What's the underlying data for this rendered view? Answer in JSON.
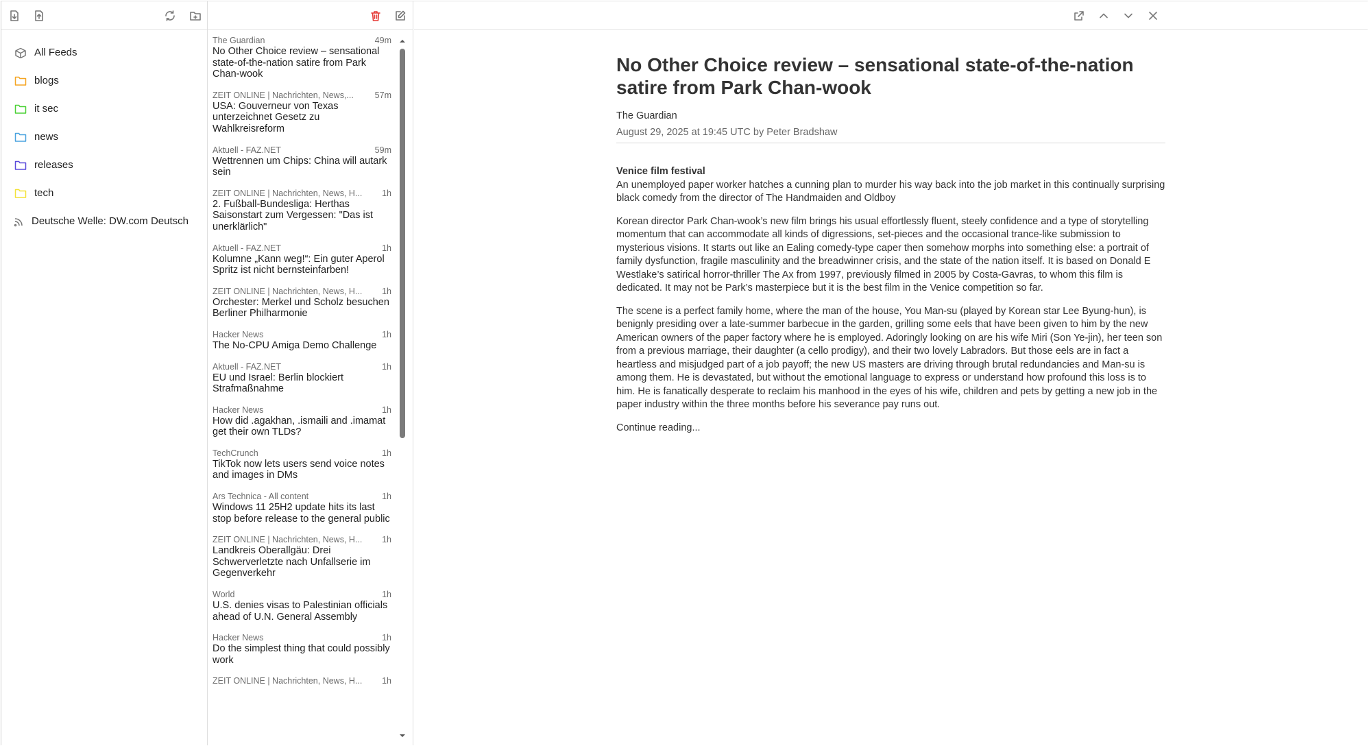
{
  "sidebar": {
    "feeds": [
      {
        "label": "All Feeds",
        "icon": "cube-icon",
        "color": "#777777"
      },
      {
        "label": "blogs",
        "icon": "folder-icon",
        "color": "#f5a623"
      },
      {
        "label": "it sec",
        "icon": "folder-icon",
        "color": "#4cd137"
      },
      {
        "label": "news",
        "icon": "folder-icon",
        "color": "#4aa3df"
      },
      {
        "label": "releases",
        "icon": "folder-icon",
        "color": "#5b4bdb"
      },
      {
        "label": "tech",
        "icon": "folder-icon",
        "color": "#f3e23a"
      },
      {
        "label": "Deutsche Welle: DW.com Deutsch",
        "icon": "rss-icon",
        "color": "#777777"
      }
    ]
  },
  "articles": [
    {
      "source": "The Guardian",
      "time": "49m",
      "title": "No Other Choice review – sensational state-of-the-nation satire from Park Chan-wook"
    },
    {
      "source": "ZEIT ONLINE | Nachrichten, News,...",
      "time": "57m",
      "title": "USA: Gouverneur von Texas unterzeichnet Gesetz zu Wahlkreisreform"
    },
    {
      "source": "Aktuell - FAZ.NET",
      "time": "59m",
      "title": "Wettrennen um Chips: China will autark sein"
    },
    {
      "source": "ZEIT ONLINE | Nachrichten, News, H...",
      "time": "1h",
      "title": "2. Fußball-Bundesliga: Herthas Saisonstart zum Vergessen: \"Das ist unerklärlich\""
    },
    {
      "source": "Aktuell - FAZ.NET",
      "time": "1h",
      "title": "Kolumne „Kann weg!“: Ein guter Aperol Spritz ist nicht bernsteinfarben!"
    },
    {
      "source": "ZEIT ONLINE | Nachrichten, News, H...",
      "time": "1h",
      "title": "Orchester: Merkel und Scholz besuchen Berliner Philharmonie"
    },
    {
      "source": "Hacker News",
      "time": "1h",
      "title": "The No-CPU Amiga Demo Challenge"
    },
    {
      "source": "Aktuell - FAZ.NET",
      "time": "1h",
      "title": "EU und Israel: Berlin blockiert Strafmaßnahme"
    },
    {
      "source": "Hacker News",
      "time": "1h",
      "title": "How did .agakhan, .ismaili and .imamat get their own TLDs?"
    },
    {
      "source": "TechCrunch",
      "time": "1h",
      "title": "TikTok now lets users send voice notes and images in DMs"
    },
    {
      "source": "Ars Technica - All content",
      "time": "1h",
      "title": "Windows 11 25H2 update hits its last stop before release to the general public"
    },
    {
      "source": "ZEIT ONLINE | Nachrichten, News, H...",
      "time": "1h",
      "title": "Landkreis Oberallgäu: Drei Schwerverletzte nach Unfallserie im Gegenverkehr"
    },
    {
      "source": "World",
      "time": "1h",
      "title": "U.S. denies visas to Palestinian officials ahead of U.N. General Assembly"
    },
    {
      "source": "Hacker News",
      "time": "1h",
      "title": "Do the simplest thing that could possibly work"
    },
    {
      "source": "ZEIT ONLINE | Nachrichten, News, H...",
      "time": "1h",
      "title": ""
    }
  ],
  "reader": {
    "title": "No Other Choice review – sensational state-of-the-nation satire from Park Chan-wook",
    "source": "The Guardian",
    "date": "August 29, 2025 at 19:45 UTC by Peter Bradshaw",
    "kicker": "Venice film festival",
    "standfirst": "An unemployed paper worker hatches a cunning plan to murder his way back into the job market in this continually surprising black comedy from the director of The Handmaiden and Oldboy",
    "paragraphs": [
      "Korean director Park Chan-wook’s new film brings his usual effortlessly fluent, steely confidence and a type of storytelling momentum that can accommodate all kinds of digressions, set-pieces and the occasional trance-like submission to mysterious visions. It starts out like an Ealing comedy-type caper then somehow morphs into something else: a portrait of family dysfunction, fragile masculinity and the breadwinner crisis, and the state of the nation itself. It is based on Donald E Westlake’s satirical horror-thriller The Ax from 1997, previously filmed in 2005 by Costa-Gavras, to whom this film is dedicated. It may not be Park’s masterpiece but it is the best film in the Venice competition so far.",
      "The scene is a perfect family home, where the man of the house, You Man-su (played by Korean star Lee Byung-hun), is benignly presiding over a late-summer barbecue in the garden, grilling some eels that have been given to him by the new American owners of the paper factory where he is employed. Adoringly looking on are his wife Miri (Son Ye-jin), her teen son from a previous marriage, their daughter (a cello prodigy), and their two lovely Labradors. But those eels are in fact a heartless and misjudged part of a job payoff; the new US masters are driving through brutal redundancies and Man-su is among them. He is devastated, but without the emotional language to express or understand how profound this loss is to him. He is fanatically desperate to reclaim his manhood in the eyes of his wife, children and pets by getting a new job in the paper industry within the three months before his severance pay runs out."
    ],
    "continue": "Continue reading..."
  },
  "colors": {
    "delete": "#e53935",
    "icon": "#777777",
    "scrollbar": "#7b7b7b"
  }
}
